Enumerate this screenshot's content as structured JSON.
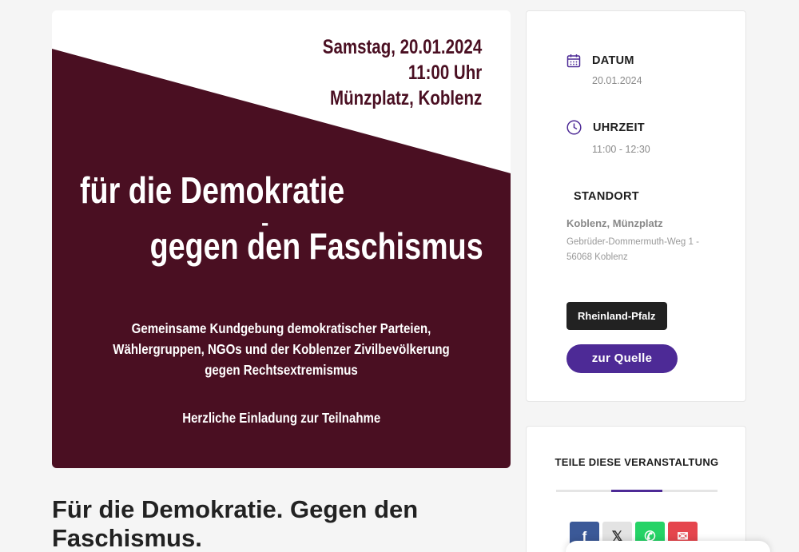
{
  "poster": {
    "date_line": "Samstag, 20.01.2024",
    "time_line": "11:00 Uhr",
    "place_line": "Münzplatz, Koblenz",
    "headline_1": "für die Demokratie",
    "dash": "-",
    "headline_2": "gegen den Faschismus",
    "subtext_lines": [
      "Gemeinsame Kundgebung demokratischer Parteien,",
      "Wählergruppen, NGOs und der Koblenzer Zivilbevölkerung",
      "gegen Rechtsextremismus"
    ],
    "invitation": "Herzliche Einladung zur Teilnahme",
    "colors": {
      "maroon": "#4a0f22",
      "white": "#ffffff"
    }
  },
  "page": {
    "title": "Für die Demokratie. Gegen den Faschismus."
  },
  "info": {
    "date_label": "DATUM",
    "date_value": "20.01.2024",
    "date_icon": "calendar-icon",
    "time_label": "UHRZEIT",
    "time_value": "11:00 - 12:30",
    "time_icon": "clock-icon",
    "location_label": "STANDORT",
    "location_name": "Koblenz, Münzplatz",
    "location_address": "Gebrüder-Dommermuth-Weg 1 - 56068 Koblenz",
    "region_tag": "Rheinland-Pfalz",
    "source_button": "zur Quelle",
    "accent_color": "#4d2a96"
  },
  "share": {
    "title": "TEILE DIESE VERANSTALTUNG",
    "buttons": [
      {
        "name": "facebook-icon",
        "glyph": "f",
        "color": "#3b5998"
      },
      {
        "name": "x-icon",
        "glyph": "𝕏",
        "color": "#e3e3e3"
      },
      {
        "name": "whatsapp-icon",
        "glyph": "✆",
        "color": "#25d366"
      },
      {
        "name": "mail-icon",
        "glyph": "✉",
        "color": "#e5454d"
      }
    ]
  }
}
